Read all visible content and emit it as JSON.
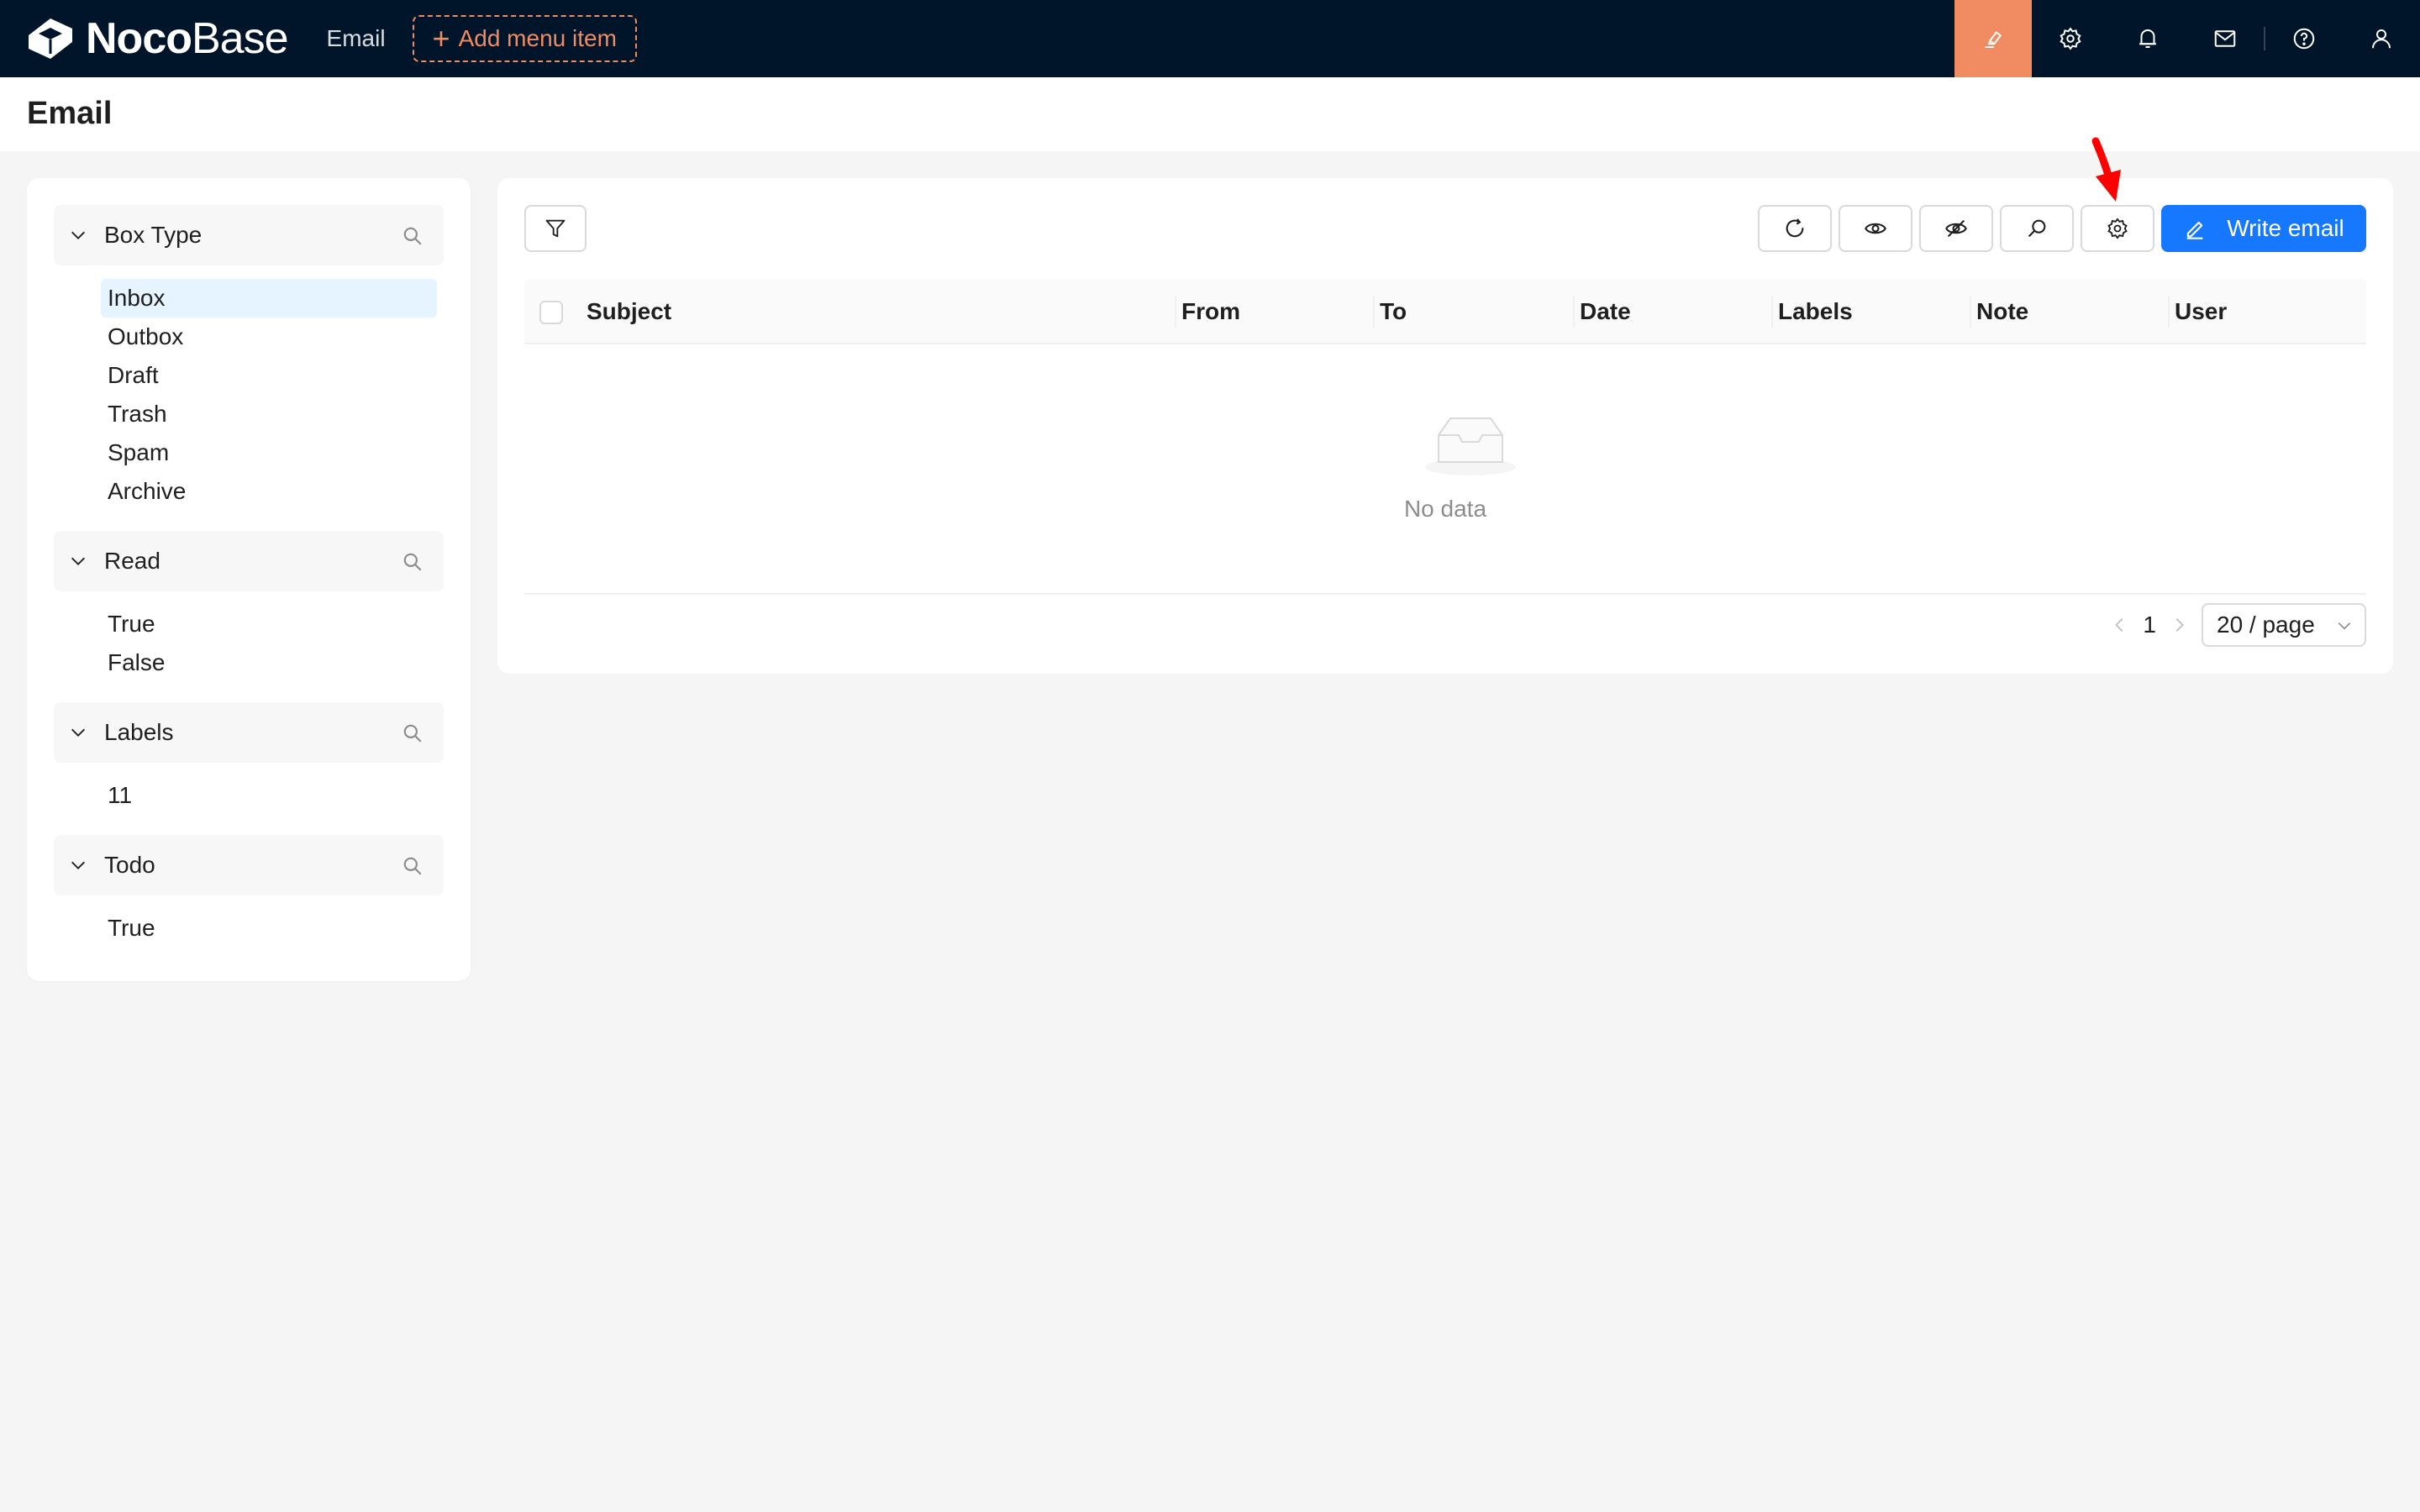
{
  "app": {
    "logo_bold": "Noco",
    "logo_light": "Base",
    "nav_item": "Email",
    "add_menu_label": "Add menu item"
  },
  "top_icons": [
    "highlighter-icon",
    "gear-icon",
    "bell-icon",
    "mail-icon",
    "help-icon",
    "user-icon"
  ],
  "page": {
    "title": "Email"
  },
  "filters": [
    {
      "title": "Box Type",
      "items": [
        "Inbox",
        "Outbox",
        "Draft",
        "Trash",
        "Spam",
        "Archive"
      ],
      "selected": "Inbox"
    },
    {
      "title": "Read",
      "items": [
        "True",
        "False"
      ]
    },
    {
      "title": "Labels",
      "items": [
        "11"
      ]
    },
    {
      "title": "Todo",
      "items": [
        "True"
      ]
    }
  ],
  "toolbar": {
    "write_email_label": "Write email",
    "icons": [
      "filter-icon",
      "refresh-icon",
      "eye-icon",
      "eye-off-icon",
      "search-icon",
      "gear-icon"
    ]
  },
  "table": {
    "columns": [
      "Subject",
      "From",
      "To",
      "Date",
      "Labels",
      "Note",
      "User"
    ],
    "empty_text": "No data"
  },
  "pagination": {
    "current_page": "1",
    "page_size": "20 / page"
  },
  "colors": {
    "topbar": "#001529",
    "accent": "#f18b62",
    "primary": "#1677ff",
    "selected_bg": "#e6f4ff",
    "annotation": "#ff0000"
  }
}
